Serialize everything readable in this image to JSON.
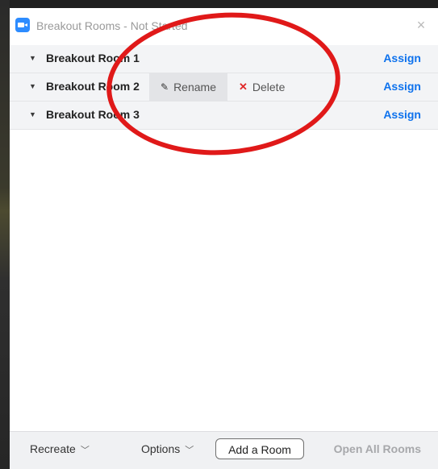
{
  "window": {
    "title": "Breakout Rooms - Not Started",
    "close_symbol": "×"
  },
  "rooms": [
    {
      "name": "Breakout Room 1",
      "assign_label": "Assign"
    },
    {
      "name": "Breakout Room 2",
      "assign_label": "Assign"
    },
    {
      "name": "Breakout Room 3",
      "assign_label": "Assign"
    }
  ],
  "row_actions": {
    "rename_label": "Rename",
    "delete_label": "Delete"
  },
  "footer": {
    "recreate_label": "Recreate",
    "options_label": "Options",
    "add_room_label": "Add a Room",
    "open_all_label": "Open All Rooms"
  },
  "icons": {
    "app": "zoom-camera-icon",
    "close": "close-icon",
    "caret": "caret-down-icon",
    "pencil": "pencil-icon",
    "delete": "x-icon",
    "chevron": "chevron-down-icon"
  },
  "colors": {
    "accent": "#0e72ed",
    "delete_red": "#e02828",
    "annotation_red": "#e01919",
    "row_bg": "#f3f4f6"
  }
}
